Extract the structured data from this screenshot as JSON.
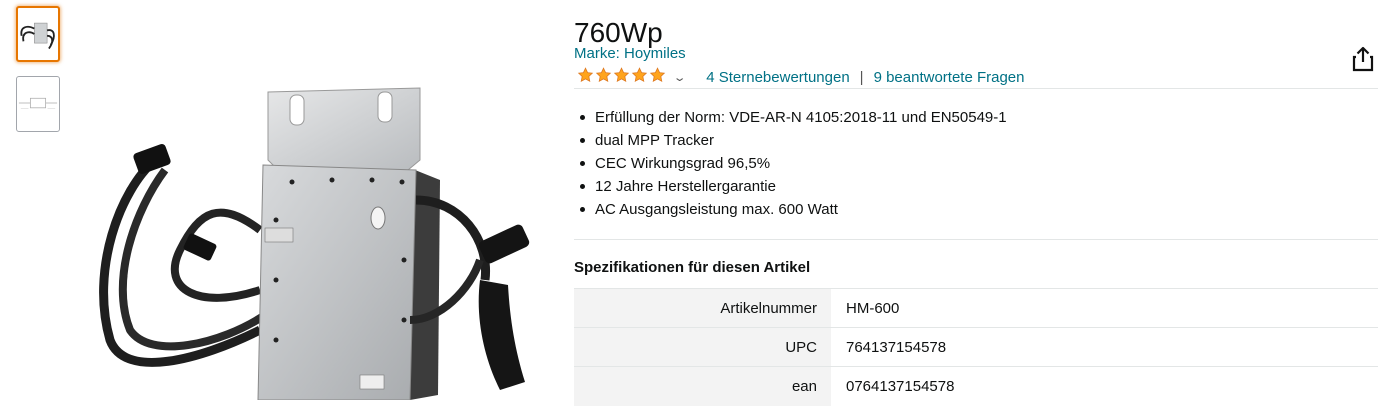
{
  "product": {
    "title_partial": "760Wp",
    "brand": "Marke: Hoymiles",
    "rating": {
      "stars": 5,
      "max_stars": 5,
      "ratings_link": "4 Sternebewertungen",
      "separator": "|",
      "questions_link": "9 beantwortete Fragen"
    },
    "bullets": [
      "Erfüllung der Norm: VDE-AR-N 4105:2018-11 und EN50549-1",
      "dual MPP Tracker",
      "CEC Wirkungsgrad 96,5%",
      "12 Jahre Herstellergarantie",
      "AC Ausgangsleistung max. 600 Watt"
    ]
  },
  "specs": {
    "heading": "Spezifikationen für diesen Artikel",
    "rows": [
      {
        "key": "Artikelnummer",
        "value": "HM-600"
      },
      {
        "key": "UPC",
        "value": "764137154578"
      },
      {
        "key": "ean",
        "value": "0764137154578"
      }
    ]
  },
  "icons": {
    "share": "share-icon",
    "star": "star-icon",
    "chevron": "chevron-down-icon"
  },
  "colors": {
    "link": "#007185",
    "star": "#ffa41c",
    "thumb_active_border": "#e77600"
  }
}
